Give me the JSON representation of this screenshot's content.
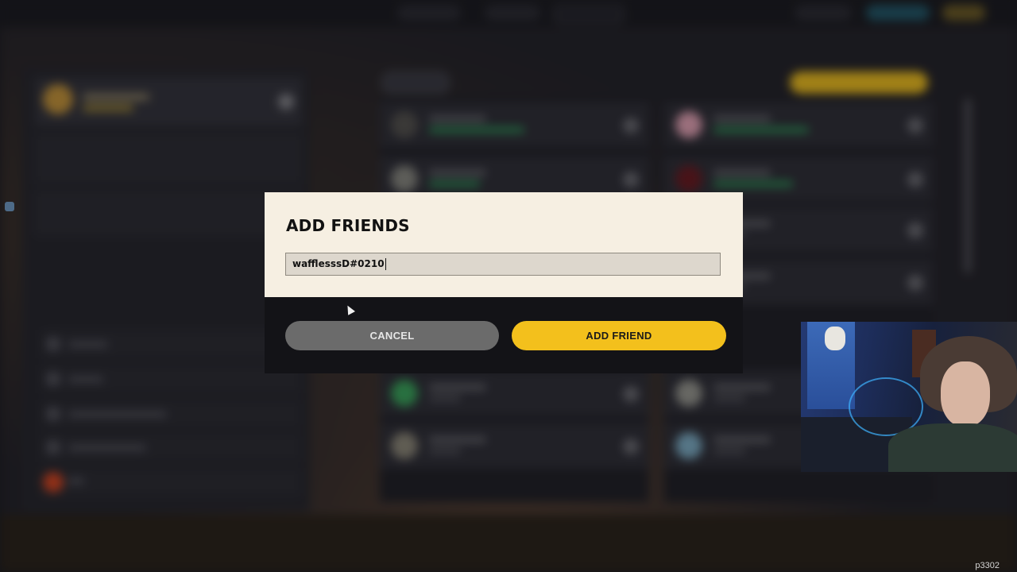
{
  "dialog": {
    "title": "ADD FRIENDS",
    "input_value": "wafflesssD#0210",
    "cancel_label": "CANCEL",
    "add_label": "ADD FRIEND"
  },
  "watermark": "p3302",
  "colors": {
    "accent_yellow": "#f3c01c",
    "dialog_bg": "#f6efe2",
    "dialog_footer": "#131317",
    "cancel_bg": "#6b6b6b"
  },
  "icons": {
    "cursor": "mouse-pointer-icon"
  }
}
